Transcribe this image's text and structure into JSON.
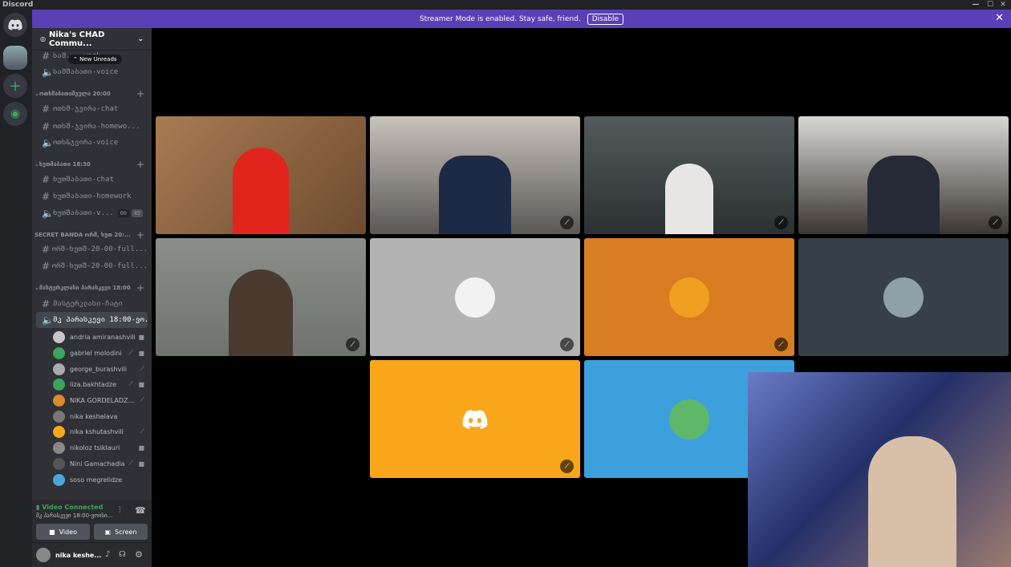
{
  "app": {
    "title": "Discord"
  },
  "banner": {
    "text": "Streamer Mode is enabled. Stay safe, friend.",
    "button": "Disable"
  },
  "server": {
    "name": "Nika's CHAD Commu..."
  },
  "tooltip": "New Unreads",
  "channels": {
    "top_text": "სამ... work",
    "top_voice": "სამშაბათი-voice",
    "cat1": "ოთხშაბათიშვულა 20:00",
    "c1a": "ოთხშ-ჯვირა-chat",
    "c1b": "ოთხშ-ჯვირა-homewo...",
    "c1c": "ოთხ&ჯვირა-voice",
    "cat2": "ხუთშაბათი 18:30",
    "c2a": "ხუთშაბათი-chat",
    "c2b": "ხუთშაბათი-homework",
    "c2c": "ხუთშაბათი-v...",
    "c2c_count1": "00",
    "c2c_count2": "45",
    "cat3": "SECRET BANDA ორშ, ხუთ 20:...",
    "c3a": "ორშ-ხუთშ-20-00-full...",
    "c3b": "ორშ-ხუთშ-20-00-full...",
    "cat4": "მასტერკლასი პარასკევი 18:00",
    "c4a": "მასტერკლასი-ჩატი",
    "c4b": "მკ პარასკევი 18:00-ვო..."
  },
  "voice_users": [
    "andria amiranashvili",
    "gabriel molodini",
    "george_burashvili",
    "liza.bakhtadze",
    "NIKA GORDELADZ...",
    "nika keshelava",
    "nika kshutashvili",
    "nikoloz tsiklauri",
    "Nini Gamachadia",
    "soso megrelidze"
  ],
  "voice_status": {
    "label": "Video Connected",
    "channel": "მკ პარასკევი 18:00-ვოისი..."
  },
  "buttons": {
    "video": "Video",
    "screen": "Screen"
  },
  "user_panel": {
    "name": "nika keshe..."
  },
  "colors": {
    "blurple": "#5865f2",
    "banner": "#5b3fb6",
    "tile_gray": "#b3b3b3",
    "tile_orange": "#d97d22",
    "tile_slate": "#36404a",
    "tile_yellow": "#faa61a",
    "tile_blue": "#3ba0dc",
    "green": "#3ba55d"
  }
}
